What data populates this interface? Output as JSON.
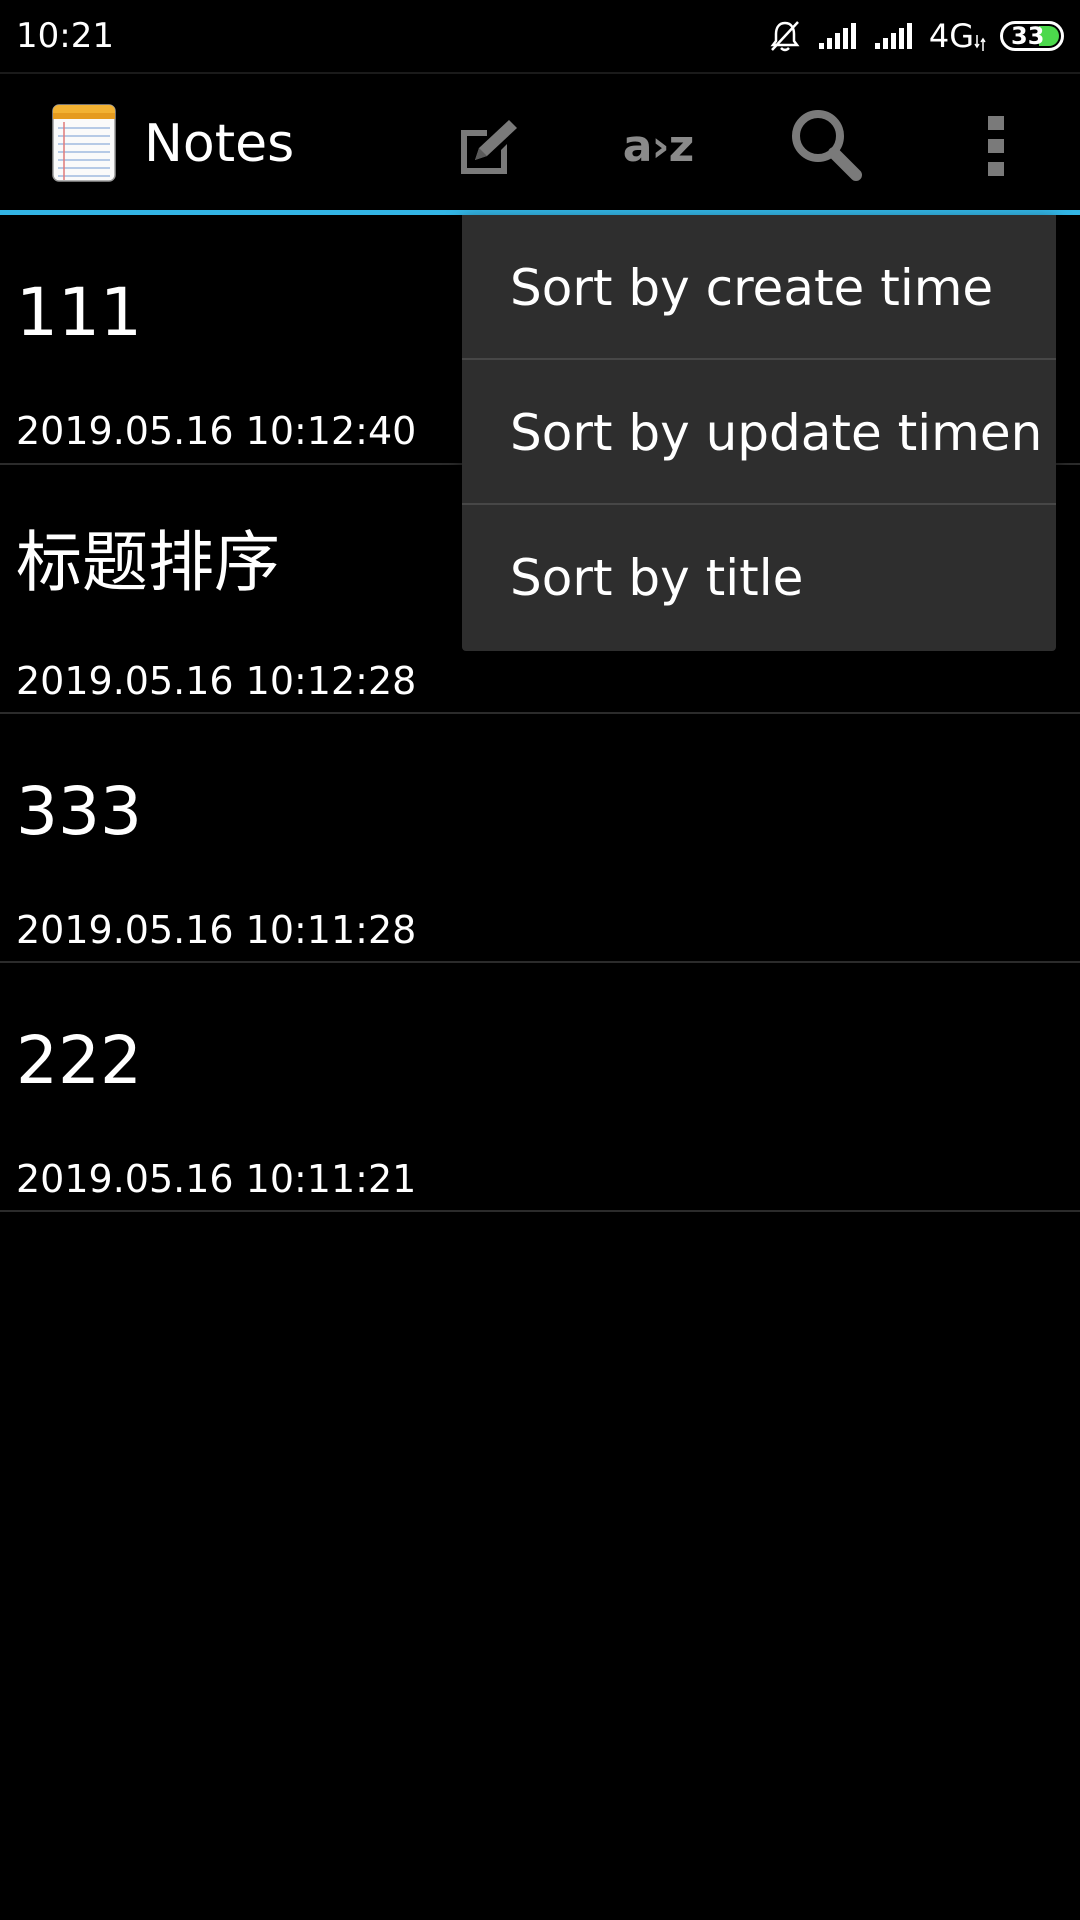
{
  "status_bar": {
    "time": "10:21",
    "network": "4G",
    "battery_level": "33",
    "icons": [
      "muted-bell-icon",
      "signal-icon",
      "signal-icon",
      "data-arrows-icon",
      "battery-icon"
    ]
  },
  "action_bar": {
    "title": "Notes",
    "sort_label": "a›z",
    "icons": [
      "notepad-icon",
      "new-note-icon",
      "sort-icon",
      "search-icon",
      "overflow-menu-icon"
    ],
    "accent_color": "#33b5e5"
  },
  "notes": [
    {
      "title": "111",
      "date": "2019.05.16 10:12:40"
    },
    {
      "title": "标题排序",
      "date": "2019.05.16 10:12:28"
    },
    {
      "title": "333",
      "date": "2019.05.16 10:11:28"
    },
    {
      "title": "222",
      "date": "2019.05.16 10:11:21"
    }
  ],
  "menu": {
    "items": [
      {
        "label": "Sort by create time"
      },
      {
        "label": "Sort by update timen"
      },
      {
        "label": "Sort by title"
      }
    ]
  }
}
